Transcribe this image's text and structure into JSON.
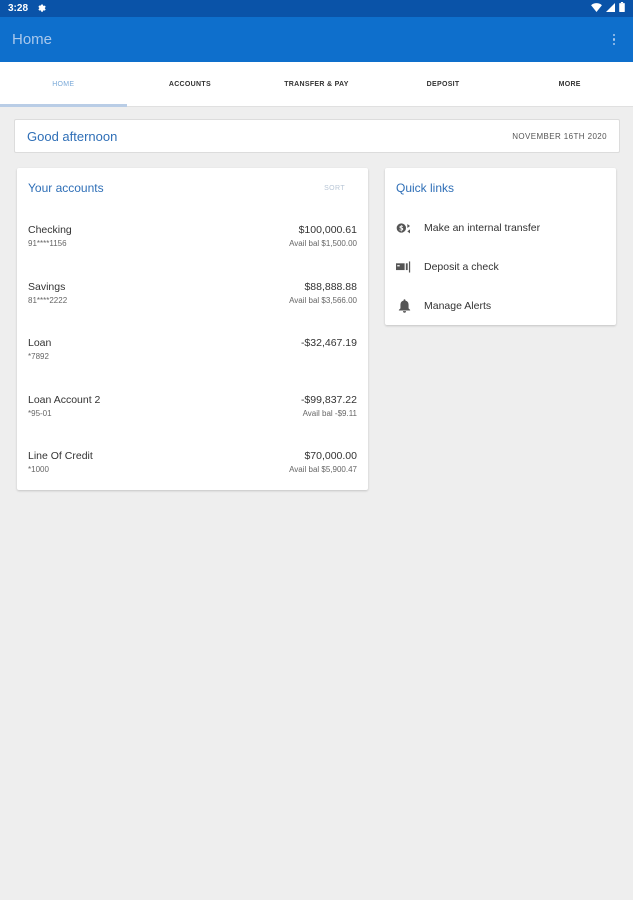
{
  "status_bar": {
    "time": "3:28"
  },
  "app_bar": {
    "title": "Home"
  },
  "tabs": [
    {
      "label": "HOME",
      "active": true
    },
    {
      "label": "ACCOUNTS",
      "active": false
    },
    {
      "label": "TRANSFER & PAY",
      "active": false
    },
    {
      "label": "DEPOSIT",
      "active": false
    },
    {
      "label": "MORE",
      "active": false
    }
  ],
  "greeting": {
    "text": "Good afternoon",
    "date": "NOVEMBER 16TH 2020"
  },
  "accounts": {
    "title": "Your accounts",
    "sort_label": "SORT",
    "items": [
      {
        "name": "Checking",
        "number": "91****1156",
        "balance": "$100,000.61",
        "avail": "Avail bal $1,500.00"
      },
      {
        "name": "Savings",
        "number": "81****2222",
        "balance": "$88,888.88",
        "avail": "Avail bal $3,566.00"
      },
      {
        "name": "Loan",
        "number": "*7892",
        "balance": "-$32,467.19",
        "avail": ""
      },
      {
        "name": "Loan Account 2",
        "number": "*95-01",
        "balance": "-$99,837.22",
        "avail": "Avail bal -$9.11"
      },
      {
        "name": "Line Of Credit",
        "number": "*1000",
        "balance": "$70,000.00",
        "avail": "Avail bal $5,900.47"
      }
    ]
  },
  "quick_links": {
    "title": "Quick links",
    "items": [
      {
        "label": "Make an internal transfer",
        "icon": "transfer-icon"
      },
      {
        "label": "Deposit a check",
        "icon": "check-deposit-icon"
      },
      {
        "label": "Manage Alerts",
        "icon": "bell-icon"
      }
    ]
  },
  "colors": {
    "status_bar": "#0a53a8",
    "app_bar": "#0e6fcc",
    "accent_text": "#2f6fb7",
    "background": "#eeeeee"
  }
}
